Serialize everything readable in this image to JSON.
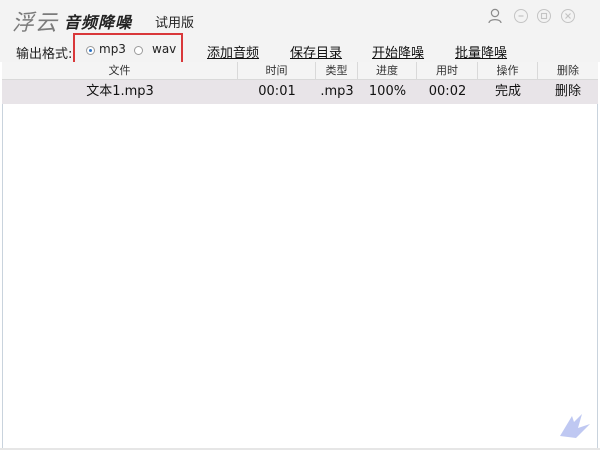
{
  "titlebar": {
    "brand": "浮云",
    "app_name": "音频降噪",
    "edition": "试用版"
  },
  "window_controls": {
    "user_icon": "user-icon",
    "minimize_icon": "minimize-icon",
    "maximize_icon": "maximize-icon",
    "close_icon": "close-icon"
  },
  "toolbar": {
    "format_label": "输出格式:",
    "format_options": [
      {
        "label": "mp3",
        "checked": true
      },
      {
        "label": "wav",
        "checked": false
      }
    ],
    "add_audio": "添加音频",
    "save_dir": "保存目录",
    "start_denoise": "开始降噪",
    "batch_denoise": "批量降噪"
  },
  "table": {
    "columns": [
      "文件",
      "时间",
      "类型",
      "进度",
      "用时",
      "操作",
      "删除"
    ],
    "rows": [
      [
        "文本1.mp3",
        "00:01",
        ".mp3",
        "100%",
        "00:02",
        "完成",
        "删除"
      ]
    ]
  },
  "colors": {
    "highlight_box": "#d9383a",
    "row_selected": "#e8e4e8",
    "chrome": "#f3f3f3"
  }
}
